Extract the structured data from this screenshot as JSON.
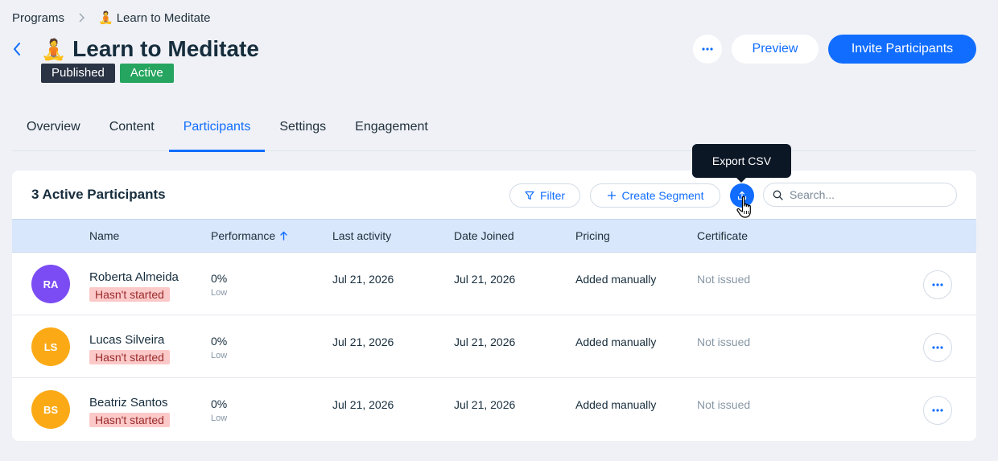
{
  "breadcrumb": {
    "root": "Programs",
    "current_emoji": "🧘",
    "current": "Learn to Meditate"
  },
  "header": {
    "title_emoji": "🧘",
    "title": "Learn to Meditate",
    "badges": [
      {
        "label": "Published",
        "color": "#2b3445"
      },
      {
        "label": "Active",
        "color": "#25a55f"
      }
    ],
    "preview_label": "Preview",
    "invite_label": "Invite Participants"
  },
  "tabs": [
    {
      "label": "Overview",
      "selected": false
    },
    {
      "label": "Content",
      "selected": false
    },
    {
      "label": "Participants",
      "selected": true
    },
    {
      "label": "Settings",
      "selected": false
    },
    {
      "label": "Engagement",
      "selected": false
    }
  ],
  "participants": {
    "title": "3 Active Participants",
    "filter_label": "Filter",
    "create_segment_label": "Create Segment",
    "export_tooltip": "Export CSV",
    "search_placeholder": "Search...",
    "columns": {
      "name": "Name",
      "performance": "Performance",
      "last_activity": "Last activity",
      "date_joined": "Date Joined",
      "pricing": "Pricing",
      "certificate": "Certificate"
    },
    "rows": [
      {
        "initials": "RA",
        "avatar_color": "#7b4cf4",
        "name": "Roberta Almeida",
        "status": "Hasn't started",
        "performance": "0%",
        "performance_level": "Low",
        "last_activity": "Jul 21, 2026",
        "date_joined": "Jul 21, 2026",
        "pricing": "Added manually",
        "certificate": "Not issued"
      },
      {
        "initials": "LS",
        "avatar_color": "#fbaa16",
        "name": "Lucas Silveira",
        "status": "Hasn't started",
        "performance": "0%",
        "performance_level": "Low",
        "last_activity": "Jul 21, 2026",
        "date_joined": "Jul 21, 2026",
        "pricing": "Added manually",
        "certificate": "Not issued"
      },
      {
        "initials": "BS",
        "avatar_color": "#fbaa16",
        "name": "Beatriz Santos",
        "status": "Hasn't started",
        "performance": "0%",
        "performance_level": "Low",
        "last_activity": "Jul 21, 2026",
        "date_joined": "Jul 21, 2026",
        "pricing": "Added manually",
        "certificate": "Not issued"
      }
    ]
  },
  "colors": {
    "accent": "#116dff",
    "background": "#eff1f6",
    "table_header": "#d9e7fd",
    "status_bg": "#fcc9c9"
  },
  "icons": {
    "breadcrumb_separator": "chevron-right-icon",
    "back": "arrow-left-icon",
    "more": "more-horizontal-icon",
    "filter": "filter-icon",
    "create_segment": "plus-icon",
    "export": "upload-icon",
    "search": "search-icon",
    "sort": "sort-ascending-icon",
    "cursor": "hand-pointer-icon"
  }
}
